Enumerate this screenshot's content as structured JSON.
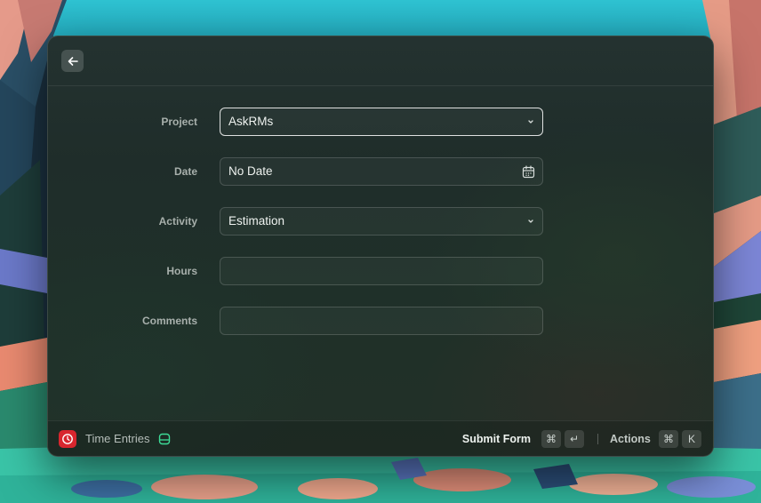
{
  "form": {
    "project": {
      "label": "Project",
      "value": "AskRMs"
    },
    "date": {
      "label": "Date",
      "value": "No Date"
    },
    "activity": {
      "label": "Activity",
      "value": "Estimation"
    },
    "hours": {
      "label": "Hours",
      "value": ""
    },
    "comments": {
      "label": "Comments",
      "value": ""
    }
  },
  "footer": {
    "app_name": "Time Entries",
    "submit_label": "Submit Form",
    "submit_keys": [
      "⌘",
      "↵"
    ],
    "actions_label": "Actions",
    "actions_keys": [
      "⌘",
      "K"
    ]
  },
  "icons": {
    "back": "arrow-left-icon",
    "dropdown": "chevron-down-icon",
    "calendar": "calendar-icon",
    "app": "clock-icon",
    "drive": "drive-icon"
  },
  "colors": {
    "app_icon_bg": "#d8262e",
    "drive_icon": "#3ddc97",
    "focus_border": "#e6ebe8"
  }
}
